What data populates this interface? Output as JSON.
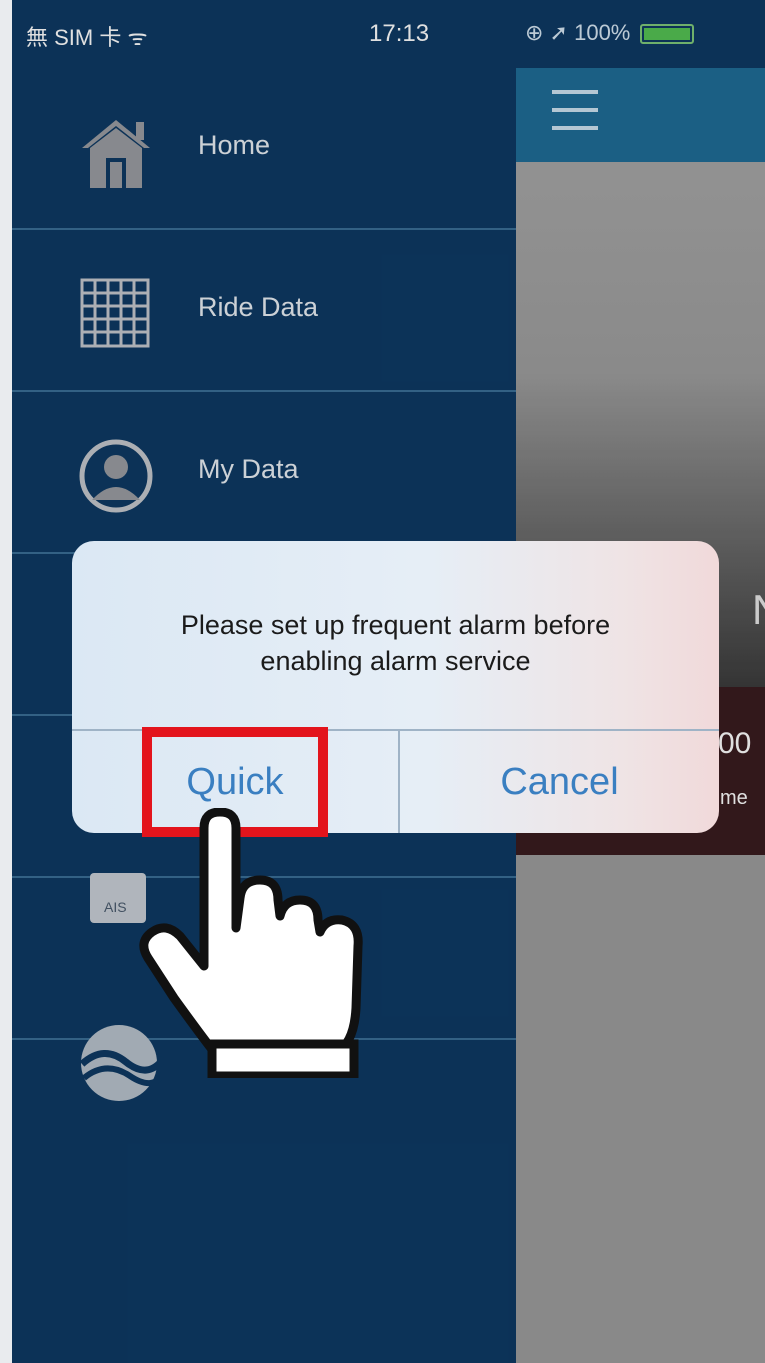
{
  "status_bar": {
    "carrier": "無 SIM 卡 ᯤ",
    "time": "17:13",
    "right": "⊕ ➚ 100%"
  },
  "menu": {
    "items": [
      {
        "label": "Home",
        "icon": "home-icon"
      },
      {
        "label": "Ride Data",
        "icon": "grid-icon"
      },
      {
        "label": "My Data",
        "icon": "user-icon"
      }
    ],
    "partial_icon_text": "AIS"
  },
  "content": {
    "hero_letter": "N",
    "band_value": "00",
    "band_sub": "me"
  },
  "alert": {
    "message_line1": "Please set up frequent alarm before",
    "message_line2": "enabling alarm service",
    "quick_label": "Quick",
    "cancel_label": "Cancel"
  },
  "colors": {
    "sidebar": "#0e3a64",
    "topbar": "#1f6d97",
    "alert_button_text": "#3a7fc1",
    "highlight": "#e3141c"
  }
}
